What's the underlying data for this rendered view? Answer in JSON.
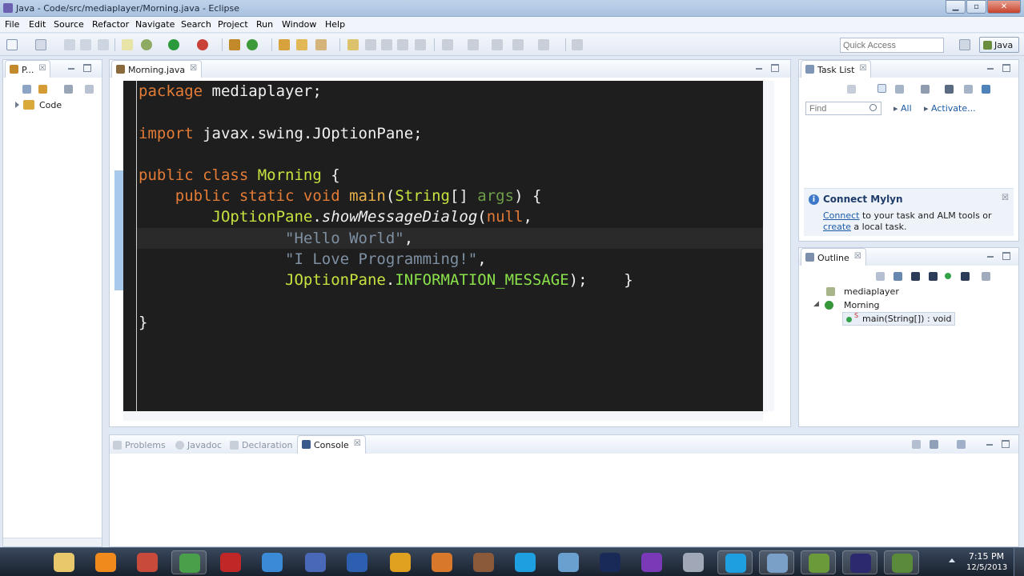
{
  "window": {
    "title": "Java - Code/src/mediaplayer/Morning.java - Eclipse",
    "minimize": "▁",
    "maximize": "▫",
    "close": "✕"
  },
  "menu": [
    "File",
    "Edit",
    "Source",
    "Refactor",
    "Navigate",
    "Search",
    "Project",
    "Run",
    "Window",
    "Help"
  ],
  "toolbar": {
    "quick_access_placeholder": "Quick Access",
    "perspective_label": "Java"
  },
  "package_explorer": {
    "tab_label": "P...",
    "close": "☒",
    "project": "Code"
  },
  "editor": {
    "tab_label": "Morning.java",
    "close": "☒",
    "code": {
      "l1_kw": "package",
      "l1_rest": " mediaplayer;",
      "l2_kw": "import",
      "l2_rest": " javax.swing.JOptionPane;",
      "l3_kw": "public class",
      "l3_cls": " Morning",
      "l3_rest": " {",
      "l4_indent": "    ",
      "l4_kw": "public static void",
      "l4_fn": " main",
      "l4_p1": "(",
      "l4_type": "String",
      "l4_p2": "[] ",
      "l4_arg": "args",
      "l4_p3": ") {",
      "l5_indent": "        ",
      "l5_cls": "JOptionPane",
      "l5_p1": ".",
      "l5_fn": "showMessageDialog",
      "l5_p2": "(",
      "l5_kw": "null",
      "l5_p3": ",",
      "l6_indent": "                ",
      "l6_str": "\"Hello World\"",
      "l6_p": ",",
      "l7_indent": "                ",
      "l7_str": "\"I Love Programming!\"",
      "l7_p": ",",
      "l8_indent": "                ",
      "l8_cls": "JOptionPane",
      "l8_p1": ".",
      "l8_const": "INFORMATION_MESSAGE",
      "l8_p2": ");    }",
      "l9": "}"
    }
  },
  "task_list": {
    "tab_label": "Task List",
    "close": "☒",
    "find_placeholder": "Find",
    "all": "All",
    "activate": "Activate..."
  },
  "mylyn": {
    "title": "Connect Mylyn",
    "close": "☒",
    "info": "i",
    "link1": "Connect",
    "text1": " to your task and ALM tools or ",
    "link2": "create",
    "text2": " a local task."
  },
  "outline": {
    "tab_label": "Outline",
    "close": "☒",
    "package": "mediaplayer",
    "class": "Morning",
    "method": "main(String[]) : void",
    "static_marker": "S"
  },
  "bottom_tabs": {
    "problems": "Problems",
    "javadoc": "Javadoc",
    "declaration": "Declaration",
    "console": "Console",
    "close": "☒"
  },
  "taskbar": {
    "time": "7:15 PM",
    "date": "12/5/2013",
    "apps": [
      {
        "name": "explorer",
        "color": "#e8c86a"
      },
      {
        "name": "vlc",
        "color": "#f08a1c"
      },
      {
        "name": "media-center",
        "color": "#c74a3a"
      },
      {
        "name": "chrome",
        "color": "#4aa04a"
      },
      {
        "name": "app-red",
        "color": "#c02828"
      },
      {
        "name": "app-blue-circle",
        "color": "#3a8ad8"
      },
      {
        "name": "dev-cpp",
        "color": "#4a68b8"
      },
      {
        "name": "book",
        "color": "#2d5fb0"
      },
      {
        "name": "app-yellow",
        "color": "#e0a020"
      },
      {
        "name": "app-cartoon",
        "color": "#d8782a"
      },
      {
        "name": "app-photo",
        "color": "#8a5a3a"
      },
      {
        "name": "skype",
        "color": "#1ea0e0"
      },
      {
        "name": "box",
        "color": "#6aa0d0"
      },
      {
        "name": "photoshop",
        "color": "#1a2a58"
      },
      {
        "name": "visual-studio",
        "color": "#7a3ab8"
      },
      {
        "name": "app-swirl",
        "color": "#a0a8b8"
      },
      {
        "name": "skype-2",
        "color": "#1ea0e0"
      },
      {
        "name": "notepad",
        "color": "#7aa0c8"
      },
      {
        "name": "app-map",
        "color": "#6a9a3a"
      },
      {
        "name": "eclipse",
        "color": "#2c2a6e"
      },
      {
        "name": "app-green",
        "color": "#5a8a3a"
      }
    ]
  }
}
